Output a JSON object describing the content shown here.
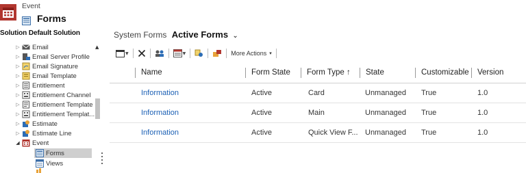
{
  "header": {
    "entity_label": "Event",
    "title": "Forms",
    "entity_icon": "calendar-icon",
    "forms_icon": "form-icon"
  },
  "sidebar": {
    "solution_label": "Solution Default Solution",
    "items": [
      {
        "label": "Email",
        "icon": "email-icon",
        "expanded": false
      },
      {
        "label": "Email Server Profile",
        "icon": "server-profile-icon",
        "expanded": false
      },
      {
        "label": "Email Signature",
        "icon": "signature-icon",
        "expanded": false
      },
      {
        "label": "Email Template",
        "icon": "template-icon",
        "expanded": false
      },
      {
        "label": "Entitlement",
        "icon": "entitlement-icon",
        "expanded": false
      },
      {
        "label": "Entitlement Channel",
        "icon": "channel-icon",
        "expanded": false
      },
      {
        "label": "Entitlement Template",
        "icon": "entitlement-template-icon",
        "expanded": false
      },
      {
        "label": "Entitlement Templat...",
        "icon": "entitlement-template-icon",
        "expanded": false
      },
      {
        "label": "Estimate",
        "icon": "estimate-icon",
        "expanded": false
      },
      {
        "label": "Estimate Line",
        "icon": "estimate-line-icon",
        "expanded": false
      },
      {
        "label": "Event",
        "icon": "calendar-icon",
        "expanded": true
      },
      {
        "label": "Forms",
        "icon": "form-icon",
        "selected": true
      },
      {
        "label": "Views",
        "icon": "views-icon"
      }
    ]
  },
  "view_selector": {
    "prefix": "System Forms",
    "active": "Active Forms",
    "chevron": "⌄"
  },
  "toolbar": {
    "more_actions_label": "More Actions",
    "more_actions_arrow": "▾"
  },
  "grid": {
    "columns": [
      "Name",
      "Form State",
      "Form Type ↑",
      "State",
      "Customizable",
      "Version"
    ],
    "rows": [
      [
        "Information",
        "Active",
        "Card",
        "Unmanaged",
        "True",
        "1.0"
      ],
      [
        "Information",
        "Active",
        "Main",
        "Unmanaged",
        "True",
        "1.0"
      ],
      [
        "Information",
        "Active",
        "Quick View F...",
        "Unmanaged",
        "True",
        "1.0"
      ]
    ]
  },
  "colors": {
    "brand_red": "#b1362f",
    "link_blue": "#1a5fb4",
    "selected_bg": "#cfcfcf"
  }
}
